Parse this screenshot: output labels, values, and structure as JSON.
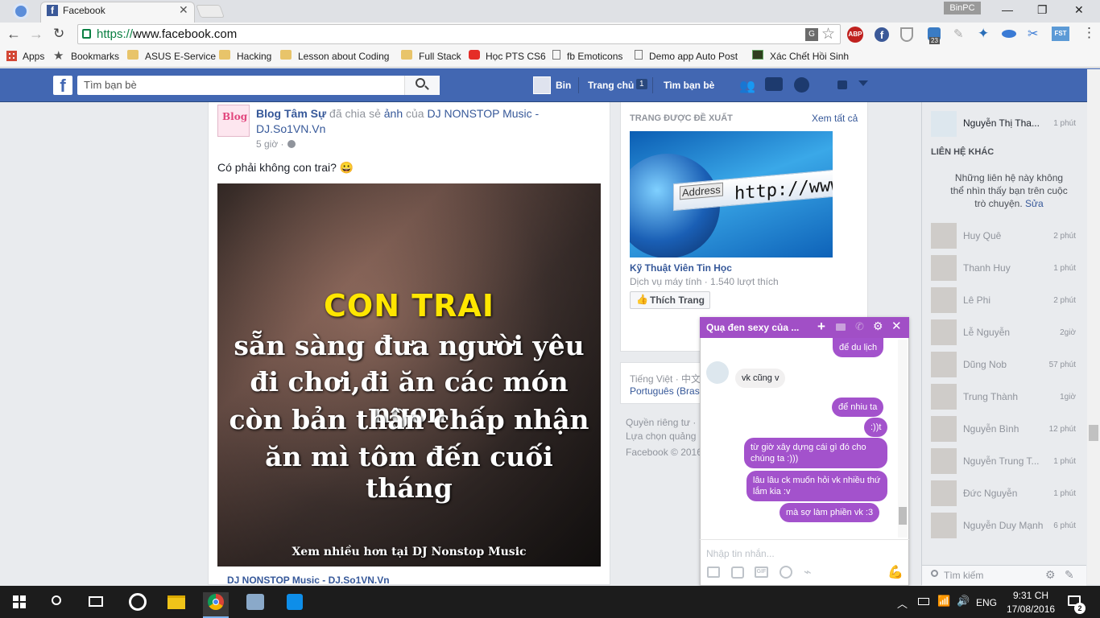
{
  "browser": {
    "tab_title": "Facebook",
    "url_scheme": "https://",
    "url_rest": "www.facebook.com",
    "user_badge": "BinPC",
    "bookmarks": [
      {
        "label": "Apps",
        "icon": "apps-grid-icon"
      },
      {
        "label": "Bookmarks",
        "icon": "star-icon"
      },
      {
        "label": "ASUS E-Service",
        "icon": "folder-icon"
      },
      {
        "label": "Hacking",
        "icon": "folder-icon"
      },
      {
        "label": "Lesson about Coding",
        "icon": "folder-icon"
      },
      {
        "label": "Full Stack",
        "icon": "folder-icon"
      },
      {
        "label": "Học PTS CS6",
        "icon": "youtube-icon"
      },
      {
        "label": "fb Emoticons",
        "icon": "page-icon"
      },
      {
        "label": "Demo app Auto Post",
        "icon": "page-icon"
      },
      {
        "label": "Xác Chết Hồi Sinh",
        "icon": "site-icon"
      }
    ]
  },
  "fb_header": {
    "search_placeholder": "Tìm bạn bè",
    "profile_name": "Bin",
    "home_label": "Trang chủ",
    "home_count": "1",
    "find_friends": "Tìm bạn bè"
  },
  "post": {
    "author": "Blog Tâm Sự",
    "shared_text": " đã chia sẻ ",
    "shared_link": "ảnh",
    "of_text": " của ",
    "page_name": "DJ NONSTOP Music - DJ.So1VN.Vn",
    "time": "5 giờ ·",
    "caption": "Có phải không con trai? 😀",
    "image_heading": "CON TRAI",
    "image_lines": [
      "sẵn sàng đưa người yêu",
      "đi chơi,đi ăn các món ngon",
      "còn bản thân chấp nhận",
      "ăn mì tôm đến cuối tháng"
    ],
    "image_footer": "Xem nhiều hơn tại DJ Nonstop Music",
    "footer_link": "DJ NONSTOP Music - DJ.So1VN.Vn"
  },
  "suggested": {
    "heading": "TRANG ĐƯỢC ĐỀ XUẤT",
    "see_all": "Xem tất cả",
    "image_address": "Address",
    "image_url": "http://www",
    "page_name": "Kỹ Thuật Viên Tin Học",
    "page_meta": "Dịch vụ máy tính · 1.540 lượt thích",
    "like_button": "Thích Trang"
  },
  "languages": {
    "line1": "Tiếng Việt · 中文",
    "line2": "Português (Bras"
  },
  "footer": {
    "line1": "Quyền riêng tư ·",
    "line2": "Lựa chọn quảng",
    "line3": "Facebook © 2016"
  },
  "sidebar": {
    "top_contact": {
      "name": "Nguyễn Thị Tha...",
      "time": "1 phút"
    },
    "other_heading": "LIÊN HỆ KHÁC",
    "notice": "Những liên hệ này không thể nhìn thấy bạn trên cuộc trò chuyện.",
    "notice_link": "Sửa",
    "contacts": [
      {
        "name": "Huy Quê",
        "time": "2 phút"
      },
      {
        "name": "Thanh Huy",
        "time": "1 phút"
      },
      {
        "name": "Lê Phi",
        "time": "2 phút"
      },
      {
        "name": "Lễ Nguyễn",
        "time": "2giờ"
      },
      {
        "name": "Dũng Nob",
        "time": "57 phút"
      },
      {
        "name": "Trung Thành",
        "time": "1giờ"
      },
      {
        "name": "Nguyễn Bình",
        "time": "12 phút"
      },
      {
        "name": "Nguyễn Trung T...",
        "time": "1 phút"
      },
      {
        "name": "Đức Nguyễn",
        "time": "1 phút"
      },
      {
        "name": "Nguyễn Duy Mạnh",
        "time": "6 phút"
      }
    ],
    "search_placeholder": "Tìm kiếm"
  },
  "chat": {
    "title": "Quạ đen sexy của ...",
    "messages": [
      {
        "dir": "out",
        "text": "để du lịch"
      },
      {
        "dir": "in",
        "text": "vk cũng v"
      },
      {
        "dir": "out",
        "text": "để nhiu ta"
      },
      {
        "dir": "out",
        "text": ":))t"
      },
      {
        "dir": "out",
        "text": "từ giờ xây dựng cái gì đó cho chúng ta :)))"
      },
      {
        "dir": "out",
        "text": "lâu lâu ck muốn hỏi vk nhiều thứ lắm kia :v"
      },
      {
        "dir": "out",
        "text": "mà sợ làm phiền vk :3"
      }
    ],
    "input_placeholder": "Nhập tin nhắn..."
  },
  "taskbar": {
    "language": "ENG",
    "time": "9:31 CH",
    "date": "17/08/2016",
    "notifications": "2"
  },
  "colors": {
    "fb_blue": "#4267b2",
    "chat_purple": "#a14fc6",
    "link_blue": "#365899",
    "image_yellow": "#ffe600"
  }
}
